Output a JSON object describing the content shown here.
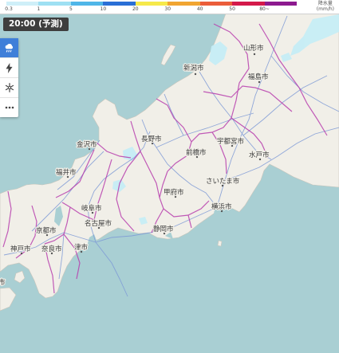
{
  "legend": {
    "ticks": [
      "0.3",
      "1",
      "5",
      "10",
      "20",
      "30",
      "40",
      "50",
      "80~"
    ],
    "title": "降水量",
    "unit": "(mm/h)",
    "colors": [
      "#cfeff8",
      "#9ee0f3",
      "#4fb6e8",
      "#2a6fd6",
      "#f6e94a",
      "#f1a531",
      "#eb5d3a",
      "#d4194a",
      "#8d1a8f"
    ]
  },
  "time": {
    "label": "20:00 (予測)"
  },
  "toolbar": {
    "items": [
      {
        "icon": "rain-cloud-icon",
        "active": true
      },
      {
        "icon": "lightning-icon",
        "active": false
      },
      {
        "icon": "snow-icon",
        "active": false
      },
      {
        "icon": "more-icon",
        "active": false
      }
    ]
  },
  "cities": {
    "yamagata": "山形市",
    "niigata": "新潟市",
    "fukushima": "福島市",
    "kanazawa": "金沢市",
    "nagano": "長野市",
    "utsunomiya": "宇都宮市",
    "maebashi": "前橋市",
    "mito": "水戸市",
    "fukui": "福井市",
    "saitama": "さいたま市",
    "kofu": "甲府市",
    "gifu": "岐阜市",
    "yokohama": "横浜市",
    "nagoya": "名古屋市",
    "shizuoka": "静岡市",
    "kyoto": "京都市",
    "tsu": "津市",
    "kobe": "神戸市",
    "nara": "奈良市",
    "partial_left": "市"
  }
}
